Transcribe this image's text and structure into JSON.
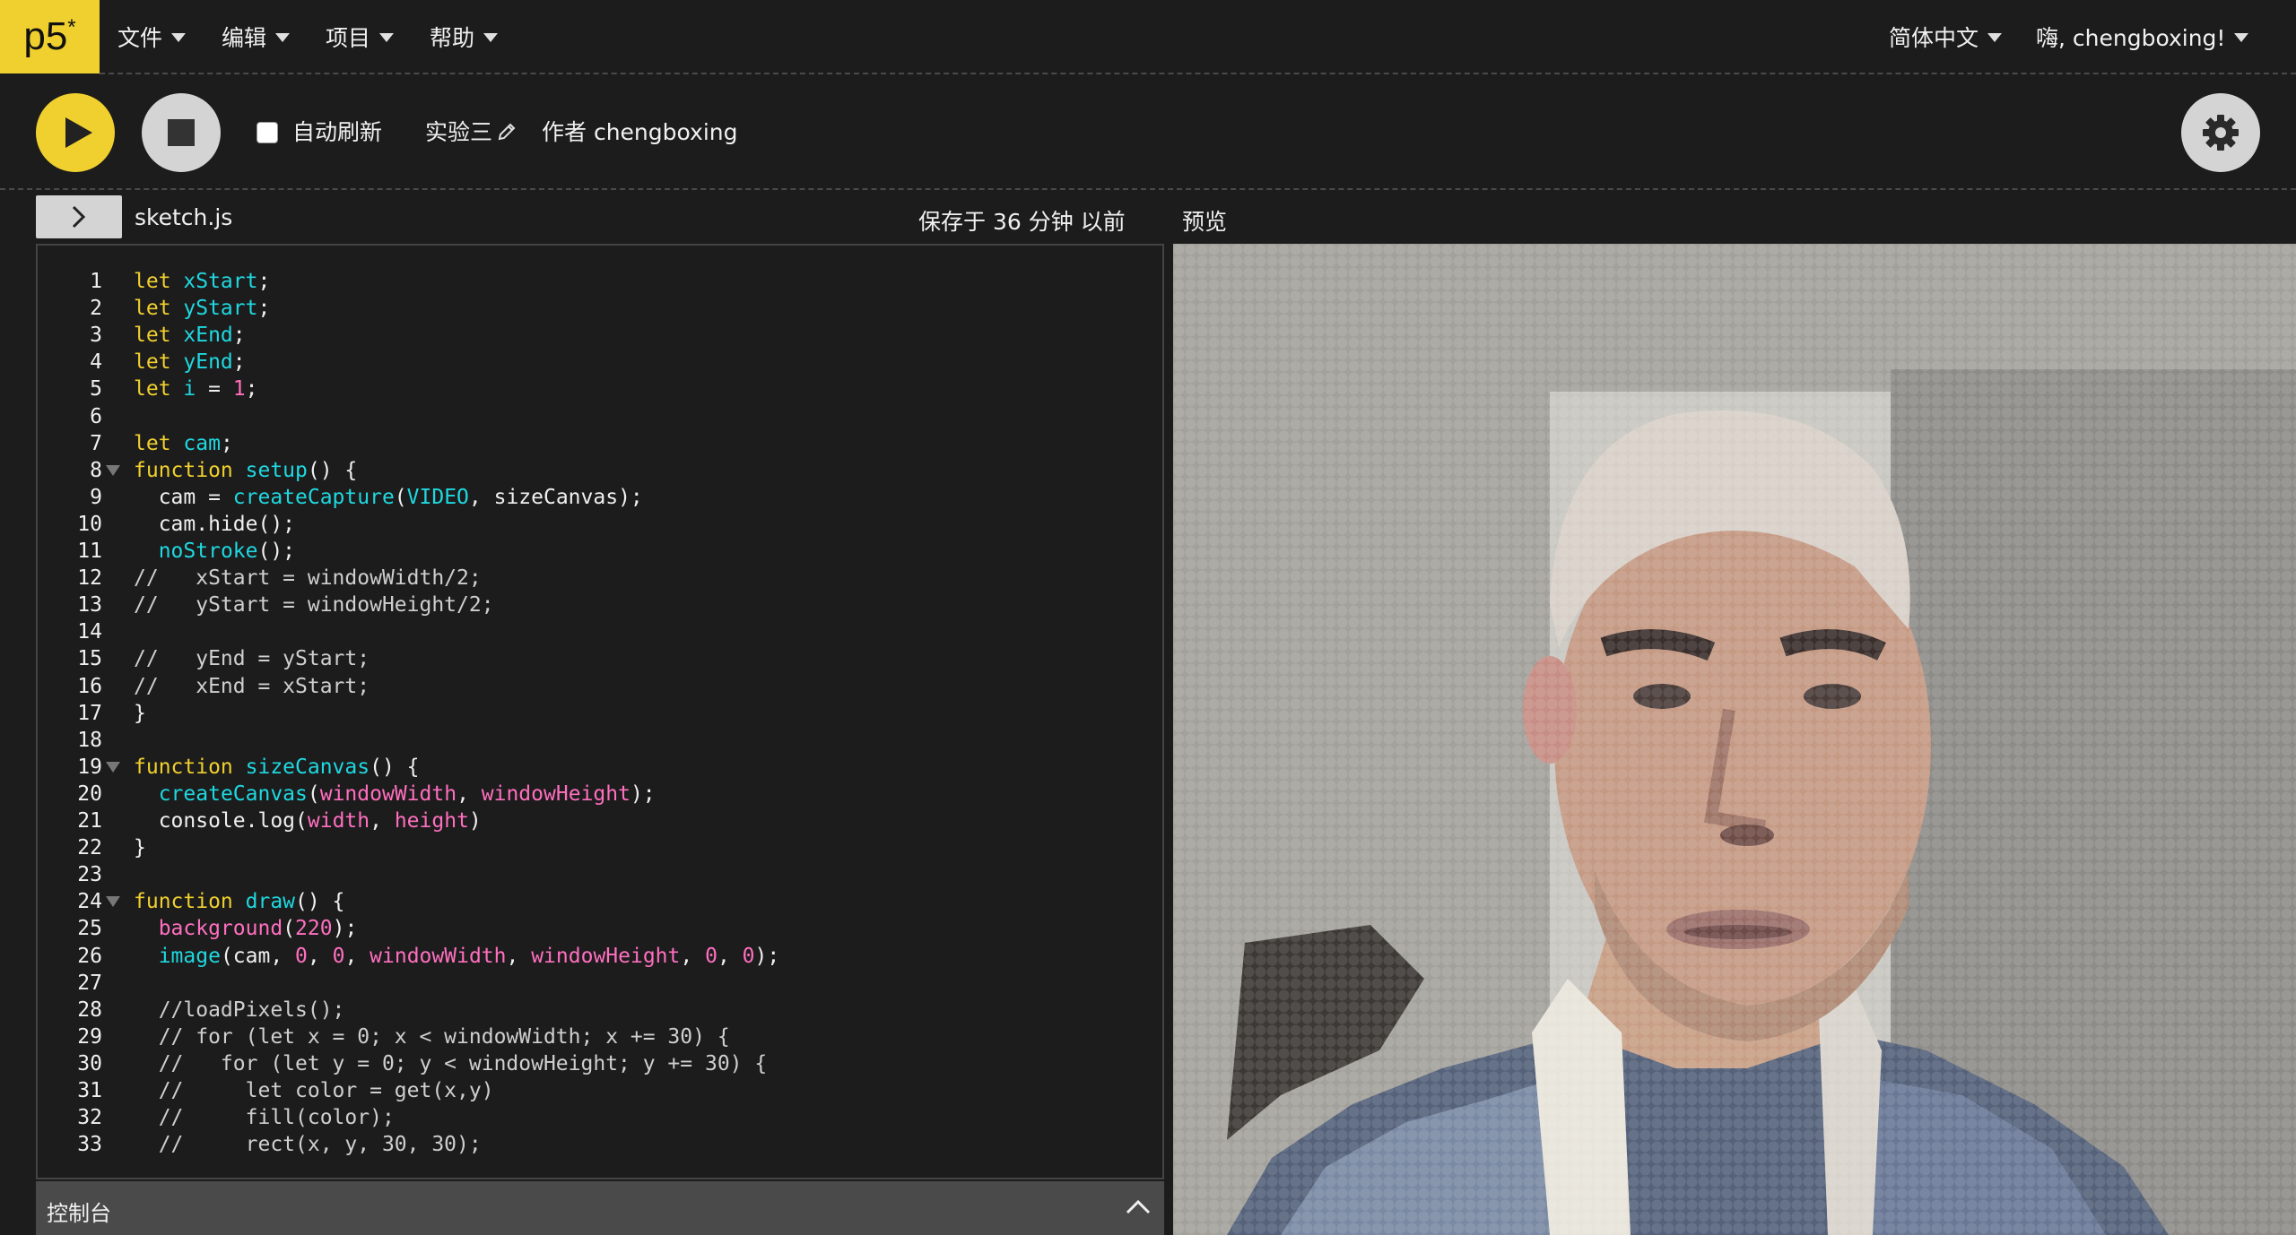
{
  "logo": {
    "text": "p5",
    "sup": "*"
  },
  "menu": [
    {
      "label": "文件"
    },
    {
      "label": "编辑"
    },
    {
      "label": "项目"
    },
    {
      "label": "帮助"
    }
  ],
  "nav_right": {
    "language": "简体中文",
    "user": "嗨, chengboxing!"
  },
  "toolbar": {
    "auto_refresh": "自动刷新",
    "sketch_name": "实验三",
    "author": "作者 chengboxing",
    "auto_refresh_checked": false
  },
  "editor": {
    "filename": "sketch.js",
    "saved_status": "保存于 36 分钟 以前",
    "preview_label": "预览",
    "line_numbers": [
      "1",
      "2",
      "3",
      "4",
      "5",
      "6",
      "7",
      "8",
      "9",
      "10",
      "11",
      "12",
      "13",
      "14",
      "15",
      "16",
      "17",
      "18",
      "19",
      "20",
      "21",
      "22",
      "23",
      "24",
      "25",
      "26",
      "27",
      "28",
      "29",
      "30",
      "31",
      "32",
      "33"
    ],
    "fold_lines": [
      "8",
      "19",
      "24"
    ],
    "code_lines": [
      [
        {
          "t": "let ",
          "c": "kw"
        },
        {
          "t": "xStart",
          "c": "id"
        },
        {
          "t": ";",
          "c": ""
        }
      ],
      [
        {
          "t": "let ",
          "c": "kw"
        },
        {
          "t": "yStart",
          "c": "id"
        },
        {
          "t": ";",
          "c": ""
        }
      ],
      [
        {
          "t": "let ",
          "c": "kw"
        },
        {
          "t": "xEnd",
          "c": "id"
        },
        {
          "t": ";",
          "c": ""
        }
      ],
      [
        {
          "t": "let ",
          "c": "kw"
        },
        {
          "t": "yEnd",
          "c": "id"
        },
        {
          "t": ";",
          "c": ""
        }
      ],
      [
        {
          "t": "let ",
          "c": "kw"
        },
        {
          "t": "i",
          "c": "id"
        },
        {
          "t": " = ",
          "c": ""
        },
        {
          "t": "1",
          "c": "pk"
        },
        {
          "t": ";",
          "c": ""
        }
      ],
      [],
      [
        {
          "t": "let ",
          "c": "kw"
        },
        {
          "t": "cam",
          "c": "id"
        },
        {
          "t": ";",
          "c": ""
        }
      ],
      [
        {
          "t": "function ",
          "c": "kw"
        },
        {
          "t": "setup",
          "c": "id"
        },
        {
          "t": "() {",
          "c": ""
        }
      ],
      [
        {
          "t": "  cam = ",
          "c": ""
        },
        {
          "t": "createCapture",
          "c": "id"
        },
        {
          "t": "(",
          "c": ""
        },
        {
          "t": "VIDEO",
          "c": "id"
        },
        {
          "t": ", sizeCanvas);",
          "c": ""
        }
      ],
      [
        {
          "t": "  cam.hide();",
          "c": ""
        }
      ],
      [
        {
          "t": "  ",
          "c": ""
        },
        {
          "t": "noStroke",
          "c": "id"
        },
        {
          "t": "();",
          "c": ""
        }
      ],
      [
        {
          "t": "//   xStart = windowWidth/2;",
          "c": "cm"
        }
      ],
      [
        {
          "t": "//   yStart = windowHeight/2;",
          "c": "cm"
        }
      ],
      [],
      [
        {
          "t": "//   yEnd = yStart;",
          "c": "cm"
        }
      ],
      [
        {
          "t": "//   xEnd = xStart;",
          "c": "cm"
        }
      ],
      [
        {
          "t": "}",
          "c": ""
        }
      ],
      [],
      [
        {
          "t": "function ",
          "c": "kw"
        },
        {
          "t": "sizeCanvas",
          "c": "id"
        },
        {
          "t": "() {",
          "c": ""
        }
      ],
      [
        {
          "t": "  ",
          "c": ""
        },
        {
          "t": "createCanvas",
          "c": "id"
        },
        {
          "t": "(",
          "c": ""
        },
        {
          "t": "windowWidth",
          "c": "pk"
        },
        {
          "t": ", ",
          "c": ""
        },
        {
          "t": "windowHeight",
          "c": "pk"
        },
        {
          "t": ");",
          "c": ""
        }
      ],
      [
        {
          "t": "  console.log(",
          "c": ""
        },
        {
          "t": "width",
          "c": "pk"
        },
        {
          "t": ", ",
          "c": ""
        },
        {
          "t": "height",
          "c": "pk"
        },
        {
          "t": ")",
          "c": ""
        }
      ],
      [
        {
          "t": "}",
          "c": ""
        }
      ],
      [],
      [
        {
          "t": "function ",
          "c": "kw"
        },
        {
          "t": "draw",
          "c": "id"
        },
        {
          "t": "() {",
          "c": ""
        }
      ],
      [
        {
          "t": "  ",
          "c": ""
        },
        {
          "t": "background",
          "c": "pk"
        },
        {
          "t": "(",
          "c": ""
        },
        {
          "t": "220",
          "c": "pk"
        },
        {
          "t": ");",
          "c": ""
        }
      ],
      [
        {
          "t": "  ",
          "c": ""
        },
        {
          "t": "image",
          "c": "id"
        },
        {
          "t": "(cam, ",
          "c": ""
        },
        {
          "t": "0",
          "c": "pk"
        },
        {
          "t": ", ",
          "c": ""
        },
        {
          "t": "0",
          "c": "pk"
        },
        {
          "t": ", ",
          "c": ""
        },
        {
          "t": "windowWidth",
          "c": "pk"
        },
        {
          "t": ", ",
          "c": ""
        },
        {
          "t": "windowHeight",
          "c": "pk"
        },
        {
          "t": ", ",
          "c": ""
        },
        {
          "t": "0",
          "c": "pk"
        },
        {
          "t": ", ",
          "c": ""
        },
        {
          "t": "0",
          "c": "pk"
        },
        {
          "t": ");",
          "c": ""
        }
      ],
      [],
      [
        {
          "t": "  //loadPixels();",
          "c": "cm"
        }
      ],
      [
        {
          "t": "  // for (let x = 0; x < windowWidth; x += 30) {",
          "c": "cm"
        }
      ],
      [
        {
          "t": "  //   for (let y = 0; y < windowHeight; y += 30) {",
          "c": "cm"
        }
      ],
      [
        {
          "t": "  //     let color = get(x,y)",
          "c": "cm"
        }
      ],
      [
        {
          "t": "  //     fill(color);",
          "c": "cm"
        }
      ],
      [
        {
          "t": "  //     rect(x, y, 30, 30);",
          "c": "cm"
        }
      ]
    ]
  },
  "console": {
    "label": "控制台"
  },
  "colors": {
    "accent": "#f0d02e",
    "keyword": "#f0d02e",
    "identifier": "#1fd8e0",
    "literal": "#ff6fbf"
  },
  "icons": {
    "play": "play-icon",
    "stop": "stop-icon",
    "settings": "gear-icon",
    "pencil": "pencil-icon",
    "sidebar": "chevron-right-icon",
    "console": "chevron-up-icon"
  }
}
